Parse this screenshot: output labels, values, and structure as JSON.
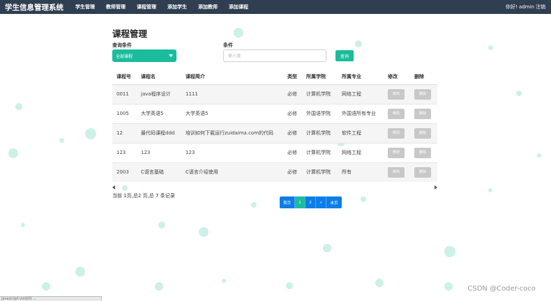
{
  "navbar": {
    "brand": "学生信息管理系统",
    "items": [
      "学生管理",
      "教师管理",
      "课程管理",
      "添加学生",
      "添加教师",
      "添加课程"
    ],
    "welcome": "你好! admin",
    "logout": "注销"
  },
  "page": {
    "title": "课程管理"
  },
  "filter": {
    "query_label": "查询条件",
    "select_value": "全部课程",
    "condition_label": "条件",
    "input_placeholder": "输入值",
    "search_button": "查询"
  },
  "table": {
    "headers": [
      "课程号",
      "课程名",
      "课程简介",
      "类型",
      "所属学院",
      "所属专业",
      "修改",
      "删除"
    ],
    "rows": [
      {
        "id": "0011",
        "name": "java程序设计",
        "intro": "1111",
        "type": "必修",
        "college": "计算机学院",
        "major": "网络工程",
        "edit": "修改",
        "delete": "删除"
      },
      {
        "id": "1005",
        "name": "大学英语5",
        "intro": "大学英语5",
        "type": "必修",
        "college": "外国语学院",
        "major": "外国语所有专业",
        "edit": "修改",
        "delete": "删除"
      },
      {
        "id": "12",
        "name": "最代码课程ddd",
        "intro": "培训如何下载运行zuidaima.com的代码",
        "type": "必修",
        "college": "计算机学院",
        "major": "软件工程",
        "edit": "修改",
        "delete": "删除"
      },
      {
        "id": "123",
        "name": "123",
        "intro": "123",
        "type": "必修",
        "college": "计算机学院",
        "major": "网络工程",
        "edit": "修改",
        "delete": "删除"
      },
      {
        "id": "2003",
        "name": "C语言基础",
        "intro": "C语言介绍使用",
        "type": "必修",
        "college": "计算机学院",
        "major": "所有",
        "edit": "修改",
        "delete": "删除"
      }
    ]
  },
  "pager": {
    "info": "当前 1页,总2 页,总 7 条记录",
    "first": "首页",
    "pages": [
      "1",
      "2"
    ],
    "current": "1",
    "next": "»",
    "last": "末页"
  },
  "watermark": "CSDN @Coder-coco",
  "status_bar": "javascript:void(0) ..."
}
